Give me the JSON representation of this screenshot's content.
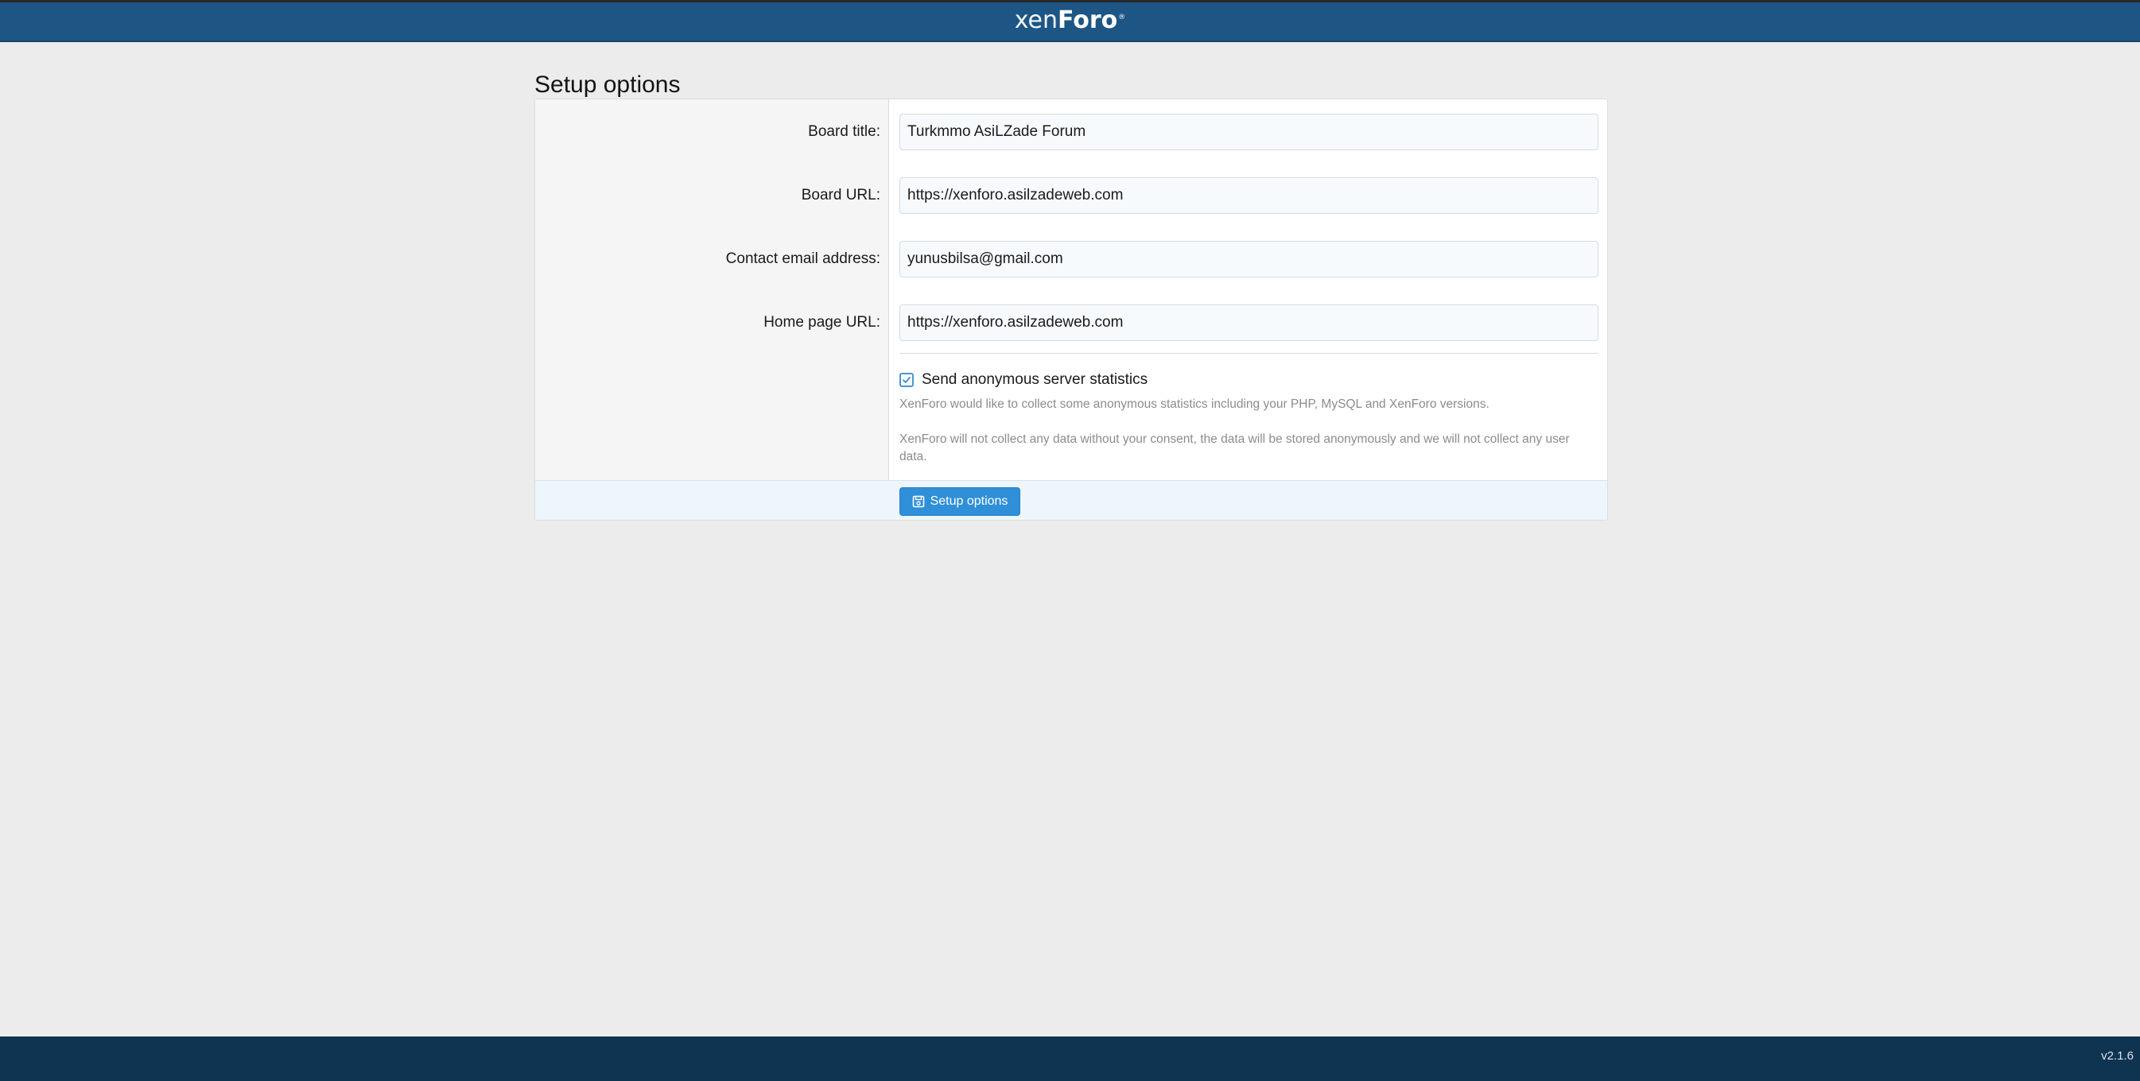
{
  "header": {
    "logo_part1": "xen",
    "logo_part2": "Foro",
    "logo_mark": "®"
  },
  "page": {
    "title": "Setup options"
  },
  "form": {
    "fields": [
      {
        "label": "Board title:",
        "value": "Turkmmo AsiLZade Forum"
      },
      {
        "label": "Board URL:",
        "value": "https://xenforo.asilzadeweb.com"
      },
      {
        "label": "Contact email address:",
        "value": "yunusbilsa@gmail.com"
      },
      {
        "label": "Home page URL:",
        "value": "https://xenforo.asilzadeweb.com"
      }
    ],
    "statistics": {
      "label": "Send anonymous server statistics",
      "checked": true,
      "explain_1": "XenForo would like to collect some anonymous statistics including your PHP, MySQL and XenForo versions.",
      "explain_2": "XenForo will not collect any data without your consent, the data will be stored anonymously and we will not collect any user data."
    },
    "submit_label": "Setup options",
    "submit_icon": "save-icon"
  },
  "footer": {
    "version": "v2.1.6"
  },
  "colors": {
    "header": "#1d5685",
    "footer": "#0f3452",
    "button": "#2f8fd8"
  }
}
